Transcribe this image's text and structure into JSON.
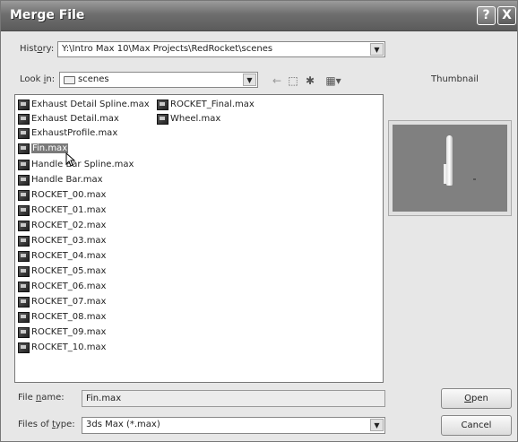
{
  "window": {
    "title": "Merge File",
    "help_glyph": "?",
    "close_glyph": "X"
  },
  "history": {
    "label_prefix": "Hist",
    "label_accel": "o",
    "label_suffix": "ry:",
    "value": "Y:\\Intro Max 10\\Max Projects\\RedRocket\\scenes"
  },
  "lookin": {
    "label_prefix": "Look ",
    "label_accel": "i",
    "label_suffix": "n:",
    "value": "scenes"
  },
  "toolbar": {
    "back_glyph": "←",
    "up_glyph": "⬚",
    "newfolder_glyph": "✱",
    "view_glyph": "▦▾"
  },
  "files": {
    "col1": [
      {
        "name": "Exhaust Detail Spline.max"
      },
      {
        "name": "Exhaust Detail.max"
      },
      {
        "name": "ExhaustProfile.max"
      },
      {
        "name": "Fin.max"
      },
      {
        "name": "Handle Bar Spline.max"
      },
      {
        "name": "Handle Bar.max"
      },
      {
        "name": "ROCKET_00.max"
      },
      {
        "name": "ROCKET_01.max"
      },
      {
        "name": "ROCKET_02.max"
      },
      {
        "name": "ROCKET_03.max"
      },
      {
        "name": "ROCKET_04.max"
      },
      {
        "name": "ROCKET_05.max"
      },
      {
        "name": "ROCKET_06.max"
      },
      {
        "name": "ROCKET_07.max"
      },
      {
        "name": "ROCKET_08.max"
      },
      {
        "name": "ROCKET_09.max"
      },
      {
        "name": "ROCKET_10.max"
      }
    ],
    "col2": [
      {
        "name": "ROCKET_Final.max"
      },
      {
        "name": "Wheel.max"
      }
    ],
    "selected": "Fin.max"
  },
  "thumbnail": {
    "label": "Thumbnail"
  },
  "filename": {
    "label_prefix": "File ",
    "label_accel": "n",
    "label_suffix": "ame:",
    "value": "Fin.max"
  },
  "filetype": {
    "label_prefix": "Files of ",
    "label_accel": "t",
    "label_suffix": "ype:",
    "value": "3ds Max (*.max)"
  },
  "buttons": {
    "open_accel": "O",
    "open_rest": "pen",
    "cancel": "Cancel"
  },
  "dropdown_arrow": "▼"
}
